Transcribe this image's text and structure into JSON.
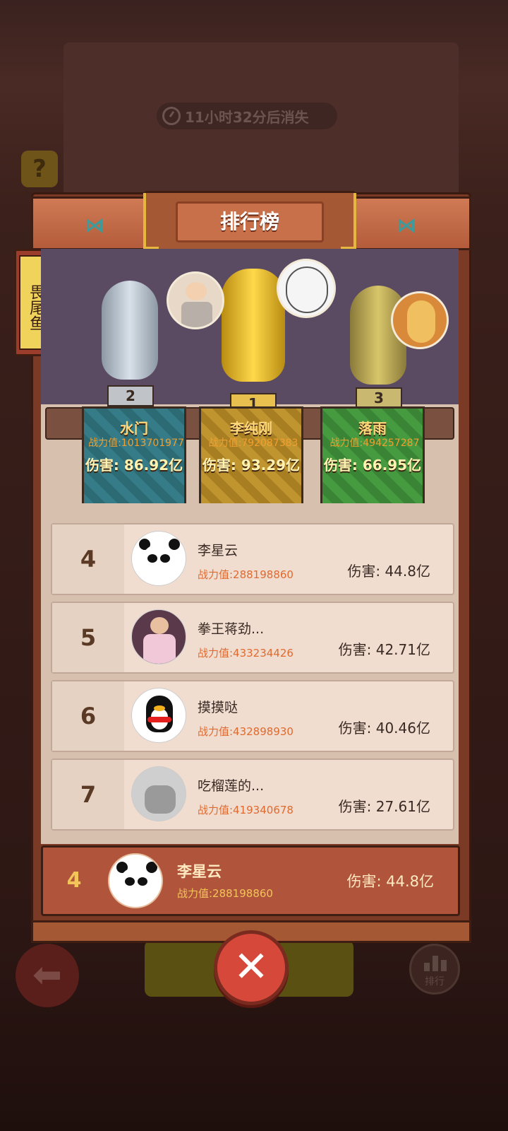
{
  "timer": {
    "text": "11小时32分后消失"
  },
  "help_label": "?",
  "panel": {
    "title": "排行榜",
    "side_tab": "畏尾鱼"
  },
  "podium": [
    {
      "place": "2",
      "name": "水门",
      "power": "战力值:1013701977",
      "damage": "伤害: 86.92亿",
      "color": "#2f6f7a"
    },
    {
      "place": "1",
      "name": "李纯刚",
      "power": "战力值:792087383",
      "damage": "伤害: 93.29亿",
      "color": "#b08a2a"
    },
    {
      "place": "3",
      "name": "落雨",
      "power": "战力值:494257287",
      "damage": "伤害: 66.95亿",
      "color": "#3f8a3a"
    }
  ],
  "rows": [
    {
      "rank": "4",
      "name": "李星云",
      "power": "战力值:288198860",
      "damage": "伤害: 44.8亿",
      "avatar": "panda-avatar"
    },
    {
      "rank": "5",
      "name": "拳王蒋劲...",
      "power": "战力值:433234426",
      "damage": "伤害: 42.71亿",
      "avatar": "person-avatar"
    },
    {
      "rank": "6",
      "name": "摸摸哒",
      "power": "战力值:432898930",
      "damage": "伤害: 40.46亿",
      "avatar": "qq-penguin-avatar"
    },
    {
      "rank": "7",
      "name": "吃榴莲的...",
      "power": "战力值:419340678",
      "damage": "伤害: 27.61亿",
      "avatar": "photo-avatar"
    }
  ],
  "self": {
    "rank": "4",
    "name": "李星云",
    "power": "战力值:288198860",
    "damage": "伤害: 44.8亿"
  },
  "bottom": {
    "rank_button_label": "排行",
    "close_label": "✕",
    "back_label": "⬅"
  },
  "colors": {
    "accent": "#d6493a",
    "gold": "#f3c45a",
    "damage_orange": "#e06a2e"
  }
}
